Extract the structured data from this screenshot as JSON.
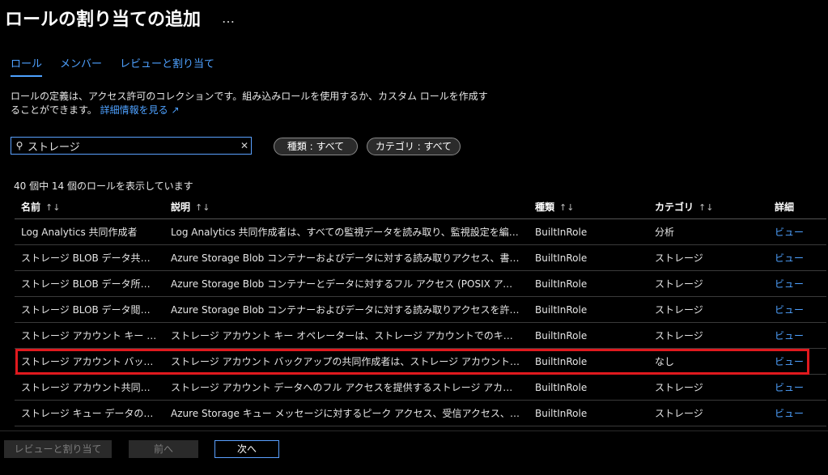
{
  "header": {
    "title": "ロールの割り当ての追加",
    "more_label": "…"
  },
  "tabs": [
    {
      "label": "ロール",
      "active": true
    },
    {
      "label": "メンバー",
      "active": false
    },
    {
      "label": "レビューと割り当て",
      "active": false
    }
  ],
  "description": {
    "text": "ロールの定義は、アクセス許可のコレクションです。組み込みロールを使用するか、カスタム ロールを作成することができます。",
    "link_label": "詳細情報を見る",
    "link_icon": "external-link-icon"
  },
  "search": {
    "value": "ストレージ",
    "icon": "search-icon",
    "clear_icon": "close-icon"
  },
  "filters": {
    "type_label": "種類 : すべて",
    "category_label": "カテゴリ : すべて"
  },
  "result_count": "40 個中 14 個のロールを表示しています",
  "table": {
    "columns": [
      "名前",
      "説明",
      "種類",
      "カテゴリ",
      "詳細"
    ],
    "sort_icon": "↑↓",
    "rows": [
      {
        "name": "Log Analytics 共同作成者",
        "description": "Log Analytics 共同作成者は、すべての監視データを読み取り、監視設定を編集でき…",
        "type": "BuiltInRole",
        "category": "分析",
        "detail": "ビュー"
      },
      {
        "name": "ストレージ BLOB データ共同作成…",
        "description": "Azure Storage Blob コンテナーおよびデータに対する読み取りアクセス、書き込みアク…",
        "type": "BuiltInRole",
        "category": "ストレージ",
        "detail": "ビュー"
      },
      {
        "name": "ストレージ BLOB データ所有者",
        "description": "Azure Storage Blob コンテナーとデータに対するフル アクセス (POSIX アクセスの制御…",
        "type": "BuiltInRole",
        "category": "ストレージ",
        "detail": "ビュー"
      },
      {
        "name": "ストレージ BLOB データ閲覧者",
        "description": "Azure Storage Blob コンテナーおよびデータに対する読み取りアクセスを許可します",
        "type": "BuiltInRole",
        "category": "ストレージ",
        "detail": "ビュー"
      },
      {
        "name": "ストレージ アカウント キー オペレー…",
        "description": "ストレージ アカウント キー オペレーターは、ストレージ アカウントでのキーの一覧表示と再…",
        "type": "BuiltInRole",
        "category": "ストレージ",
        "detail": "ビュー"
      },
      {
        "name": "ストレージ アカウント バックアップ…",
        "description": "ストレージ アカウント バックアップの共同作成者は、ストレージ アカウントのバックアップと…",
        "type": "BuiltInRole",
        "category": "なし",
        "detail": "ビュー"
      },
      {
        "name": "ストレージ アカウント共同作成者",
        "description": "ストレージ アカウント データへのフル アクセスを提供するストレージ アカウント キーへのア…",
        "type": "BuiltInRole",
        "category": "ストレージ",
        "detail": "ビュー"
      },
      {
        "name": "ストレージ キュー データのメッセージ…",
        "description": "Azure Storage キュー メッセージに対するピーク アクセス、受信アクセス、削除アクセス…",
        "type": "BuiltInRole",
        "category": "ストレージ",
        "detail": "ビュー"
      }
    ]
  },
  "footer": {
    "review_label": "レビューと割り当て",
    "prev_label": "前へ",
    "next_label": "次へ"
  },
  "colors": {
    "accent": "#4ea1ff",
    "highlight": "#e0191e",
    "background": "#000000"
  }
}
